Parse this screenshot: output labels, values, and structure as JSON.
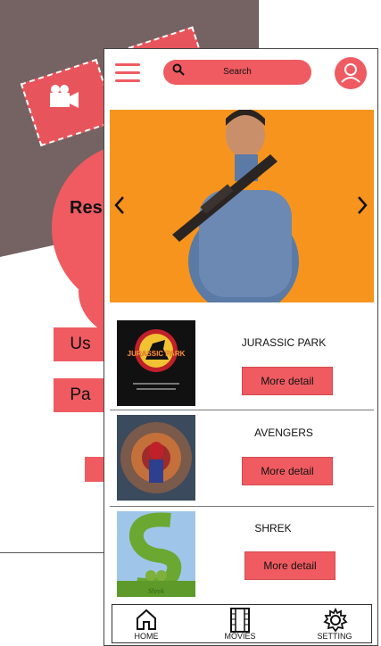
{
  "back_screen": {
    "title": "Res",
    "buttons": [
      "Us",
      "Pa",
      ""
    ]
  },
  "header": {
    "search_placeholder": "Search"
  },
  "banner": {
    "description": ""
  },
  "movies": [
    {
      "title": "JURASSIC PARK",
      "button": "More detail",
      "poster_text": "JURASSIC PARK"
    },
    {
      "title": "AVENGERS",
      "button": "More detail",
      "poster_text": ""
    },
    {
      "title": "SHREK",
      "button": "More detail",
      "poster_text": "Shrek"
    }
  ],
  "nav": [
    {
      "label": "HOME",
      "icon": "home-icon"
    },
    {
      "label": "MOVIES",
      "icon": "film-icon"
    },
    {
      "label": "SETTING",
      "icon": "gear-icon"
    }
  ],
  "colors": {
    "accent": "#ef5b61",
    "back_top": "#756363",
    "banner_bg": "#f7941d"
  }
}
